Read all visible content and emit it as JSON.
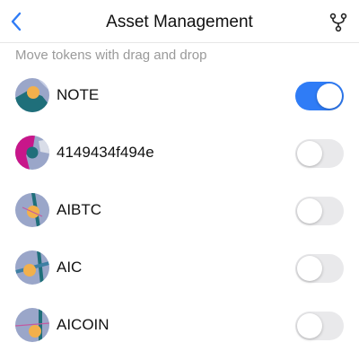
{
  "header": {
    "title": "Asset Management",
    "back_icon": "chevron-left-icon",
    "action_icon": "branch-icon"
  },
  "hint": "Move tokens with drag and drop",
  "colors": {
    "accent": "#2f7cf6",
    "toggle_off": "#e9e9eb",
    "hint_text": "#9a9a9a"
  },
  "tokens": [
    {
      "name": "NOTE",
      "enabled": true
    },
    {
      "name": "4149434f494e",
      "enabled": false
    },
    {
      "name": "AIBTC",
      "enabled": false
    },
    {
      "name": "AIC",
      "enabled": false
    },
    {
      "name": "AICOIN",
      "enabled": false
    }
  ]
}
